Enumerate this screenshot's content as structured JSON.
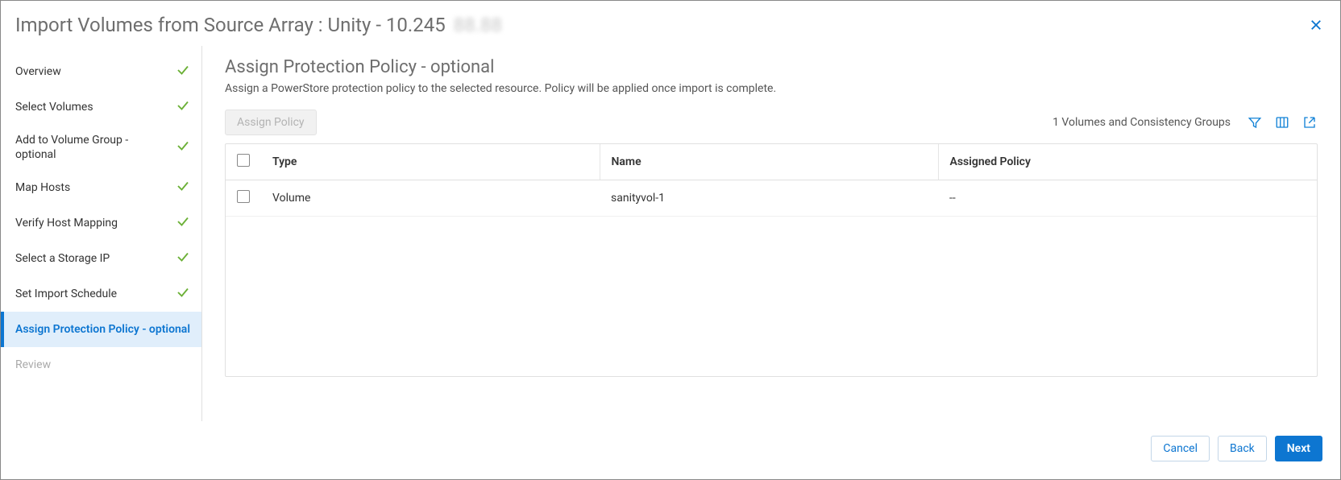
{
  "header": {
    "title_prefix": "Import Volumes from Source Array : Unity - 10.245",
    "title_masked": "88.88"
  },
  "sidebar": {
    "items": [
      {
        "label": "Overview",
        "done": true,
        "active": false
      },
      {
        "label": "Select Volumes",
        "done": true,
        "active": false
      },
      {
        "label": "Add to Volume Group - optional",
        "done": true,
        "active": false
      },
      {
        "label": "Map Hosts",
        "done": true,
        "active": false
      },
      {
        "label": "Verify Host Mapping",
        "done": true,
        "active": false
      },
      {
        "label": "Select a Storage IP",
        "done": true,
        "active": false
      },
      {
        "label": "Set Import Schedule",
        "done": true,
        "active": false
      },
      {
        "label": "Assign Protection Policy - optional",
        "done": false,
        "active": true
      },
      {
        "label": "Review",
        "done": false,
        "active": false,
        "muted": true
      }
    ]
  },
  "main": {
    "heading": "Assign Protection Policy - optional",
    "subtitle": "Assign a PowerStore protection policy to the selected resource. Policy will be applied once import is complete.",
    "assign_button": "Assign Policy",
    "counter": "1 Volumes and Consistency Groups",
    "columns": {
      "type": "Type",
      "name": "Name",
      "policy": "Assigned Policy"
    },
    "rows": [
      {
        "type": "Volume",
        "name": "sanityvol-1",
        "policy": "--"
      }
    ]
  },
  "footer": {
    "cancel": "Cancel",
    "back": "Back",
    "next": "Next"
  }
}
